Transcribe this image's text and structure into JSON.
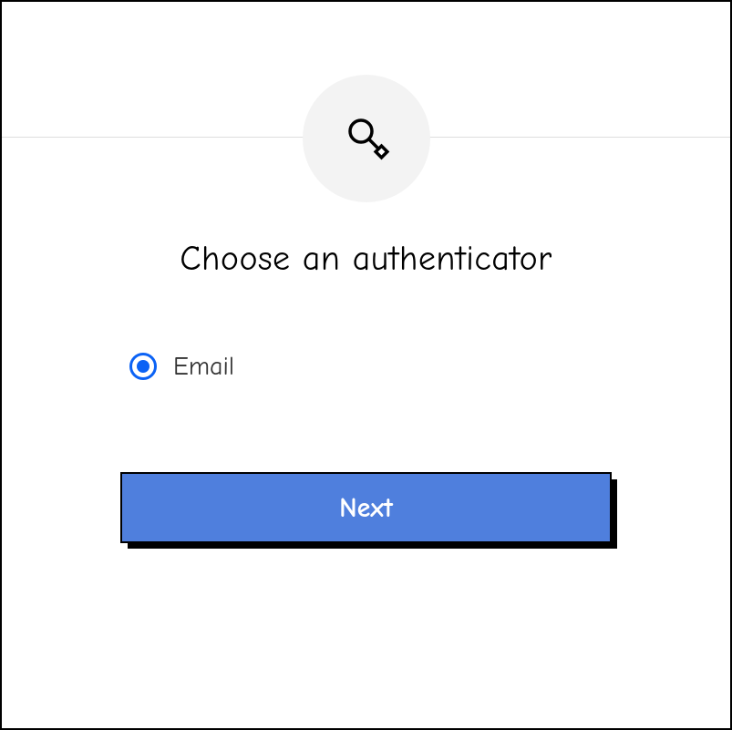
{
  "header": {
    "icon": "key-icon"
  },
  "title": "Choose an authenticator",
  "options": [
    {
      "label": "Email",
      "selected": true
    }
  ],
  "actions": {
    "next_label": "Next"
  },
  "colors": {
    "accent_blue": "#0b62f5",
    "button_blue": "#4f7fdd",
    "icon_bg": "#f3f3f3"
  }
}
